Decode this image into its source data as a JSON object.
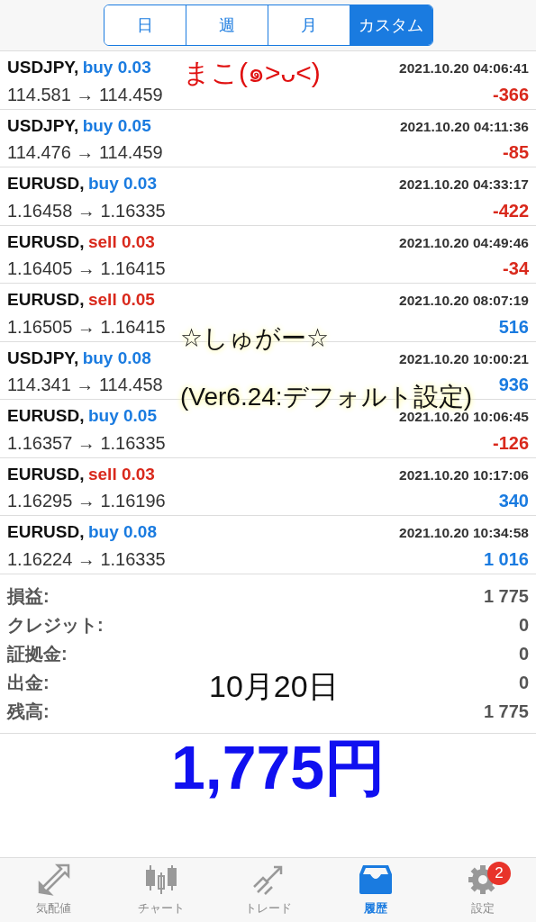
{
  "period_tabs": [
    {
      "label": "日",
      "selected": false
    },
    {
      "label": "週",
      "selected": false
    },
    {
      "label": "月",
      "selected": false
    },
    {
      "label": "カスタム",
      "selected": true
    }
  ],
  "trades": [
    {
      "symbol": "USDJPY,",
      "kind": "buy",
      "order": "buy 0.03",
      "time": "2021.10.20 04:06:41",
      "prices": "114.581 → 114.459",
      "profit": "-366",
      "loss": true
    },
    {
      "symbol": "USDJPY,",
      "kind": "buy",
      "order": "buy 0.05",
      "time": "2021.10.20 04:11:36",
      "prices": "114.476 → 114.459",
      "profit": "-85",
      "loss": true
    },
    {
      "symbol": "EURUSD,",
      "kind": "buy",
      "order": "buy 0.03",
      "time": "2021.10.20 04:33:17",
      "prices": "1.16458 → 1.16335",
      "profit": "-422",
      "loss": true
    },
    {
      "symbol": "EURUSD,",
      "kind": "sell",
      "order": "sell 0.03",
      "time": "2021.10.20 04:49:46",
      "prices": "1.16405 → 1.16415",
      "profit": "-34",
      "loss": true
    },
    {
      "symbol": "EURUSD,",
      "kind": "sell",
      "order": "sell 0.05",
      "time": "2021.10.20 08:07:19",
      "prices": "1.16505 → 1.16415",
      "profit": "516",
      "loss": false
    },
    {
      "symbol": "USDJPY,",
      "kind": "buy",
      "order": "buy 0.08",
      "time": "2021.10.20 10:00:21",
      "prices": "114.341 → 114.458",
      "profit": "936",
      "loss": false
    },
    {
      "symbol": "EURUSD,",
      "kind": "buy",
      "order": "buy 0.05",
      "time": "2021.10.20 10:06:45",
      "prices": "1.16357 → 1.16335",
      "profit": "-126",
      "loss": true
    },
    {
      "symbol": "EURUSD,",
      "kind": "sell",
      "order": "sell 0.03",
      "time": "2021.10.20 10:17:06",
      "prices": "1.16295 → 1.16196",
      "profit": "340",
      "loss": false
    },
    {
      "symbol": "EURUSD,",
      "kind": "buy",
      "order": "buy 0.08",
      "time": "2021.10.20 10:34:58",
      "prices": "1.16224 → 1.16335",
      "profit": "1 016",
      "loss": false
    }
  ],
  "summary": [
    {
      "label": "損益:",
      "value": "1 775"
    },
    {
      "label": "クレジット:",
      "value": "0"
    },
    {
      "label": "証拠金:",
      "value": "0"
    },
    {
      "label": "出金:",
      "value": "0"
    },
    {
      "label": "残高:",
      "value": "1 775"
    }
  ],
  "annotations": {
    "name_note": "まこ(๑˃ᴗ˂)",
    "title_note": "☆しゅがー☆",
    "version_note": "(Ver6.24:デフォルト設定)",
    "date_note": "10月20日",
    "total_note": "1,775円"
  },
  "bottom_nav": [
    {
      "kind": "quotes",
      "label": "気配値",
      "selected": false
    },
    {
      "kind": "chart",
      "label": "チャート",
      "selected": false
    },
    {
      "kind": "trade",
      "label": "トレード",
      "selected": false
    },
    {
      "kind": "history",
      "label": "履歴",
      "selected": true
    },
    {
      "kind": "settings",
      "label": "設定",
      "selected": false,
      "badge": "2"
    }
  ]
}
